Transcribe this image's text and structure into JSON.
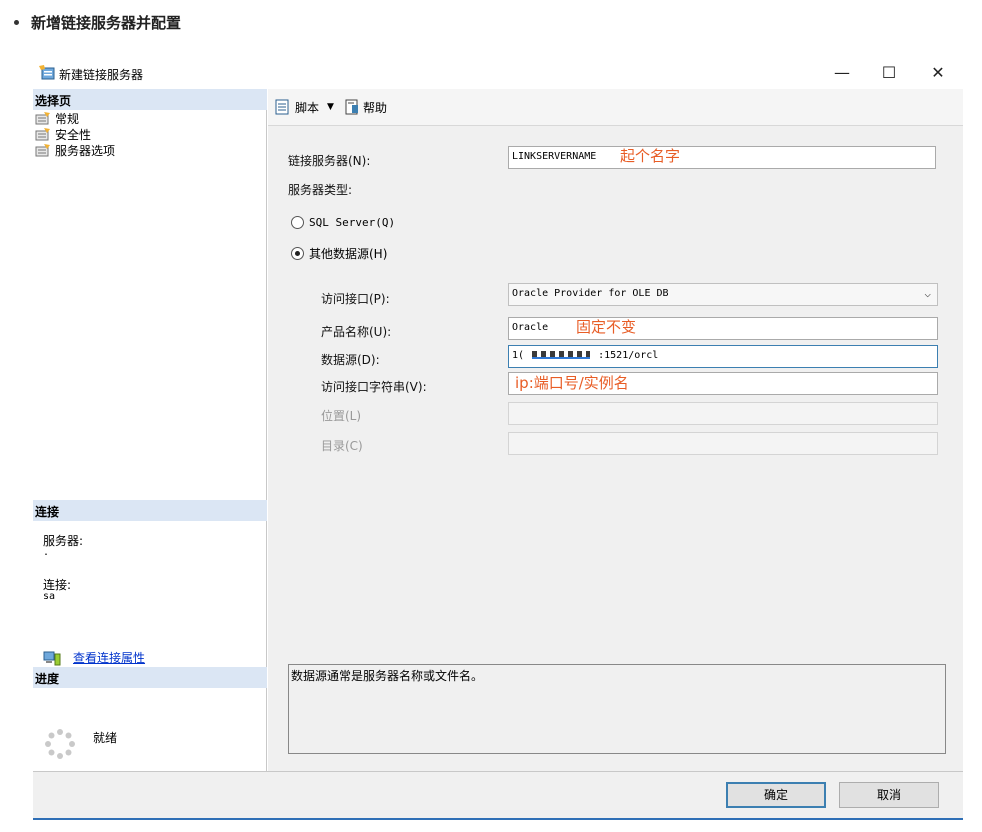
{
  "page": {
    "heading": "新增链接服务器并配置"
  },
  "window": {
    "title": "新建链接服务器",
    "minimize": "—",
    "maximize": "☐",
    "close": "✕"
  },
  "left": {
    "pages_header": "选择页",
    "pages": [
      {
        "label": "常规",
        "icon": "page-general-icon"
      },
      {
        "label": "安全性",
        "icon": "page-security-icon"
      },
      {
        "label": "服务器选项",
        "icon": "page-server-options-icon"
      }
    ],
    "connection_header": "连接",
    "server_label": "服务器:",
    "server_value": ".",
    "connection_label": "连接:",
    "connection_value": "sa",
    "view_props_link": "查看连接属性",
    "progress_header": "进度",
    "progress_status": "就绪"
  },
  "toolbar": {
    "script_label": "脚本",
    "script_arrow": "▼",
    "help_label": "帮助"
  },
  "form": {
    "linked_server_label": "链接服务器(N):",
    "linked_server_value": "LINKSERVERNAME",
    "linked_server_note": "起个名字",
    "server_type_label": "服务器类型:",
    "radio_sql_label": "SQL Server(Q)",
    "radio_other_label": "其他数据源(H)",
    "provider_label": "访问接口(P):",
    "provider_value": "Oracle Provider for OLE DB",
    "product_label": "产品名称(U):",
    "product_value": "Oracle",
    "product_note": "固定不变",
    "datasource_label": "数据源(D):",
    "datasource_value_prefix": "1(",
    "datasource_value_suffix": ":1521/orcl",
    "provider_string_label": "访问接口字符串(V):",
    "datasource_note": "ip:端口号/实例名",
    "location_label": "位置(L)",
    "catalog_label": "目录(C)",
    "description": "数据源通常是服务器名称或文件名。"
  },
  "footer": {
    "ok_label": "确定",
    "cancel_label": "取消"
  },
  "colors": {
    "annotation": "#e85d26",
    "section_header": "#dbe6f4",
    "link": "#0033cc"
  }
}
